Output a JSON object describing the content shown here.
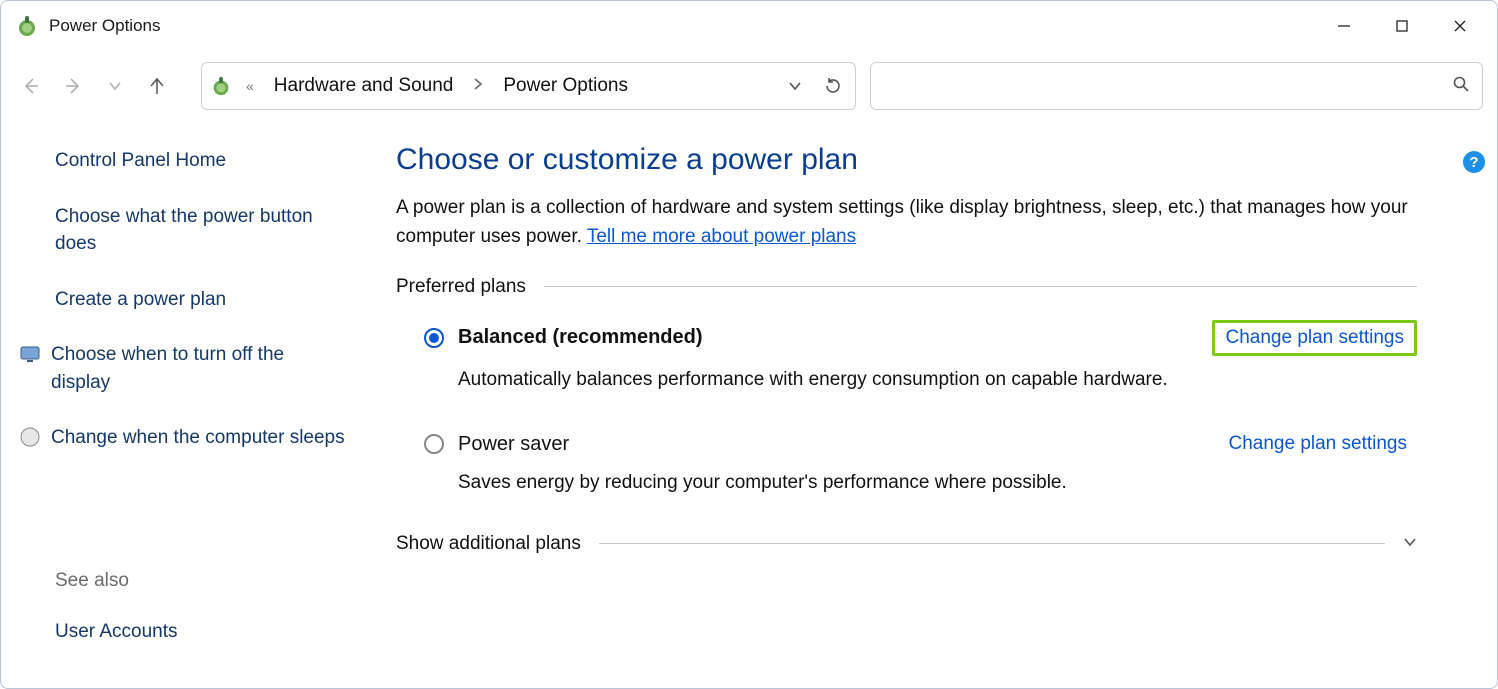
{
  "window": {
    "title": "Power Options"
  },
  "breadcrumb": {
    "segment1": "Hardware and Sound",
    "segment2": "Power Options"
  },
  "sidebar": {
    "home": "Control Panel Home",
    "link_power_button": "Choose what the power button does",
    "link_create_plan": "Create a power plan",
    "link_display_off": "Choose when to turn off the display",
    "link_sleep": "Change when the computer sleeps",
    "see_also_heading": "See also",
    "see_also_user_accounts": "User Accounts"
  },
  "main": {
    "heading": "Choose or customize a power plan",
    "desc_prefix": "A power plan is a collection of hardware and system settings (like display brightness, sleep, etc.) that manages how your computer uses power. ",
    "desc_link": "Tell me more about power plans",
    "preferred_label": "Preferred plans",
    "additional_label": "Show additional plans",
    "plans": [
      {
        "name": "Balanced (recommended)",
        "desc": "Automatically balances performance with energy consumption on capable hardware.",
        "change": "Change plan settings",
        "selected": true,
        "highlight": true
      },
      {
        "name": "Power saver",
        "desc": "Saves energy by reducing your computer's performance where possible.",
        "change": "Change plan settings",
        "selected": false,
        "highlight": false
      }
    ]
  },
  "help_tooltip": "?"
}
